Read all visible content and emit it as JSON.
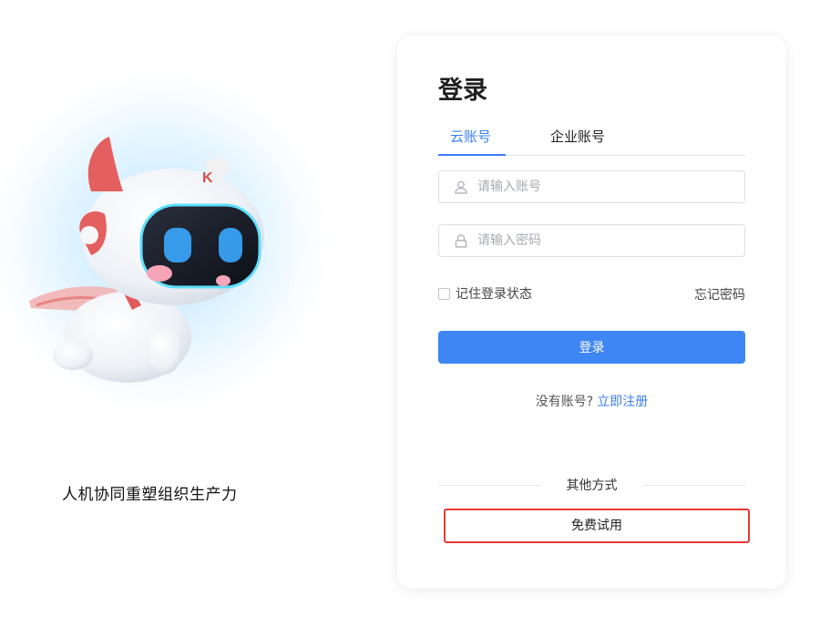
{
  "hero": {
    "tagline": "人机协同重塑组织生产力"
  },
  "login": {
    "title": "登录",
    "tabs": [
      {
        "label": "云账号",
        "active": true
      },
      {
        "label": "企业账号",
        "active": false
      }
    ],
    "account": {
      "value": "",
      "placeholder": "请输入账号",
      "icon": "user-icon"
    },
    "password": {
      "value": "",
      "placeholder": "请输入密码",
      "icon": "lock-icon"
    },
    "remember_label": "记住登录状态",
    "remember_checked": false,
    "forgot_label": "忘记密码",
    "submit_label": "登录",
    "no_account_text": "没有账号?",
    "register_link": "立即注册",
    "other_methods": "其他方式",
    "free_trial": "免费试用"
  },
  "colors": {
    "accent": "#3d86f4",
    "link": "#3b7ef0",
    "highlight_border": "#e53935"
  }
}
